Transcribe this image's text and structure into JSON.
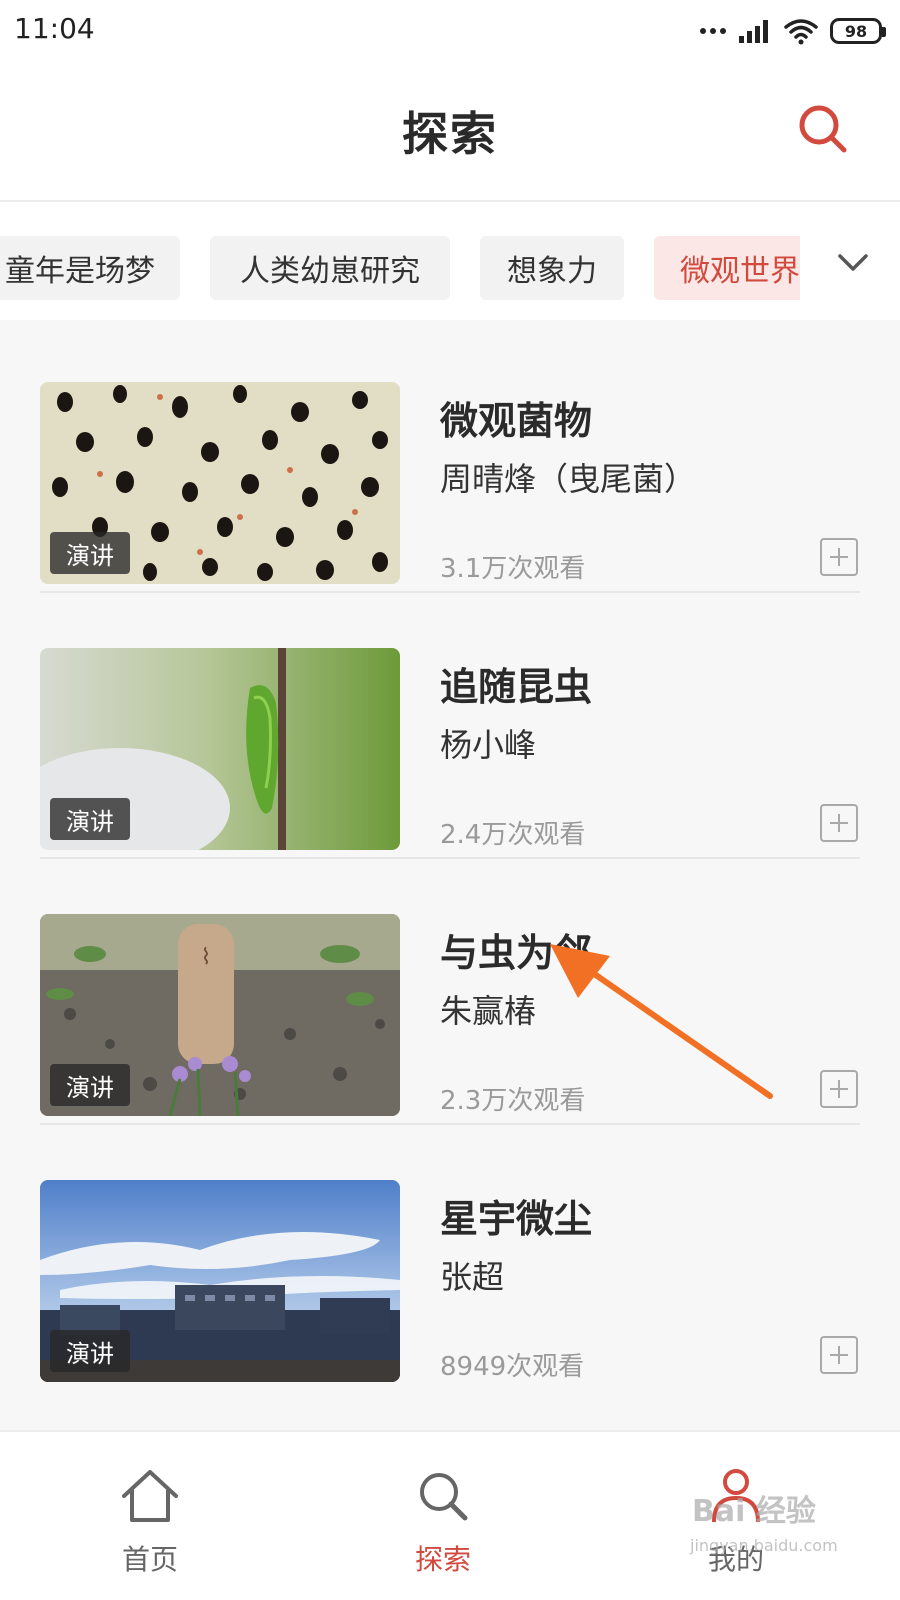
{
  "status_bar": {
    "time": "11:04",
    "battery": "98"
  },
  "header": {
    "title": "探索"
  },
  "tags": [
    {
      "label": "童年是场梦",
      "active": false
    },
    {
      "label": "人类幼崽研究",
      "active": false
    },
    {
      "label": "想象力",
      "active": false
    },
    {
      "label": "微观世界",
      "active": true
    }
  ],
  "items": [
    {
      "title": "微观菌物",
      "author": "周晴烽（曳尾菌）",
      "views": "3.1万次观看",
      "badge": "演讲"
    },
    {
      "title": "追随昆虫",
      "author": "杨小峰",
      "views": "2.4万次观看",
      "badge": "演讲"
    },
    {
      "title": "与虫为邻",
      "author": "朱赢椿",
      "views": "2.3万次观看",
      "badge": "演讲"
    },
    {
      "title": "星宇微尘",
      "author": "张超",
      "views": "8949次观看",
      "badge": "演讲"
    }
  ],
  "nav": [
    {
      "label": "首页",
      "icon": "home-icon",
      "active": false
    },
    {
      "label": "探索",
      "icon": "search-icon",
      "active": true
    },
    {
      "label": "我的",
      "icon": "user-icon",
      "active": false
    }
  ],
  "watermark": {
    "brand": "Bai 经验",
    "url": "jingyan.baidu.com"
  },
  "colors": {
    "accent": "#d24a3e",
    "arrow": "#f27024",
    "list_bg": "#f7f7f7"
  }
}
